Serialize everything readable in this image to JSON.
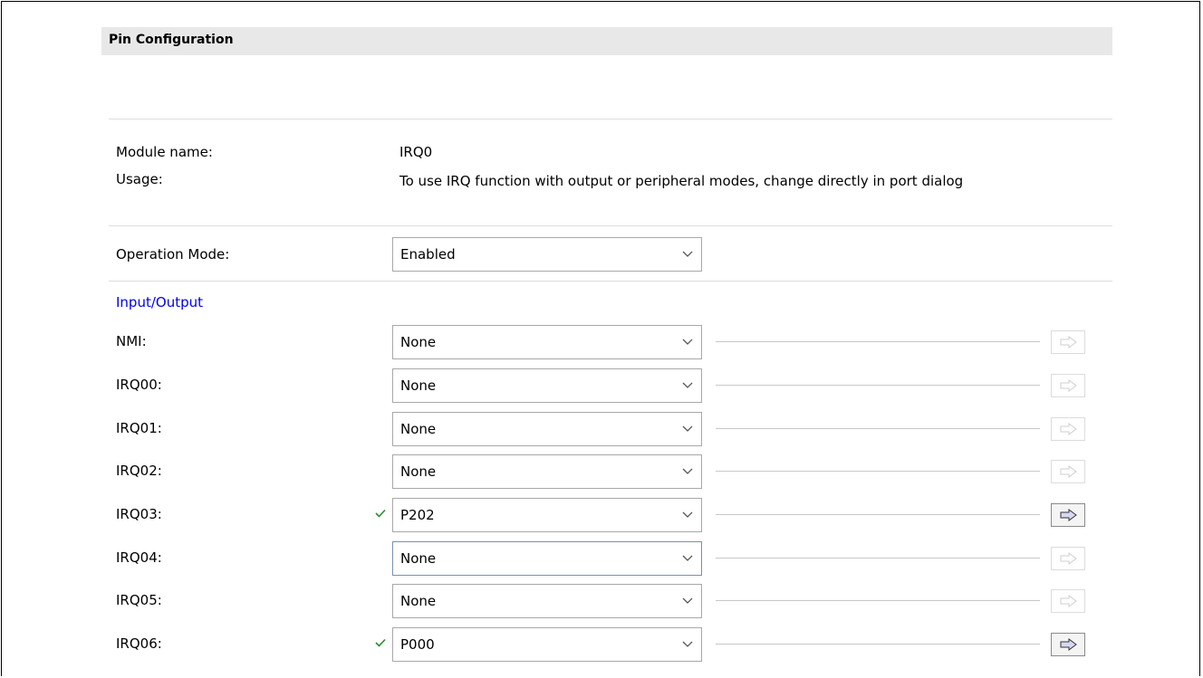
{
  "header": {
    "title": "Pin Configuration"
  },
  "module": {
    "name_label": "Module name:",
    "name_value": "IRQ0"
  },
  "usage": {
    "label": "Usage:",
    "text": "To use IRQ function with output or peripheral modes, change directly in port dialog"
  },
  "operation_mode": {
    "label": "Operation Mode:",
    "value": "Enabled"
  },
  "section": {
    "title": "Input/Output"
  },
  "pins": [
    {
      "label": "NMI:",
      "value": "None",
      "assigned": false
    },
    {
      "label": "IRQ00:",
      "value": "None",
      "assigned": false
    },
    {
      "label": "IRQ01:",
      "value": "None",
      "assigned": false
    },
    {
      "label": "IRQ02:",
      "value": "None",
      "assigned": false
    },
    {
      "label": "IRQ03:",
      "value": "P202",
      "assigned": true
    },
    {
      "label": "IRQ04:",
      "value": "None",
      "assigned": false
    },
    {
      "label": "IRQ05:",
      "value": "None",
      "assigned": false
    },
    {
      "label": "IRQ06:",
      "value": "P000",
      "assigned": true
    }
  ],
  "icons": {
    "assigned": "check-icon",
    "navigate": "arrow-right-icon",
    "dropdown": "chevron-down-icon"
  },
  "colors": {
    "link": "#0000ee",
    "check": "#2e8b2e",
    "header_bg": "#e8e8e8"
  }
}
